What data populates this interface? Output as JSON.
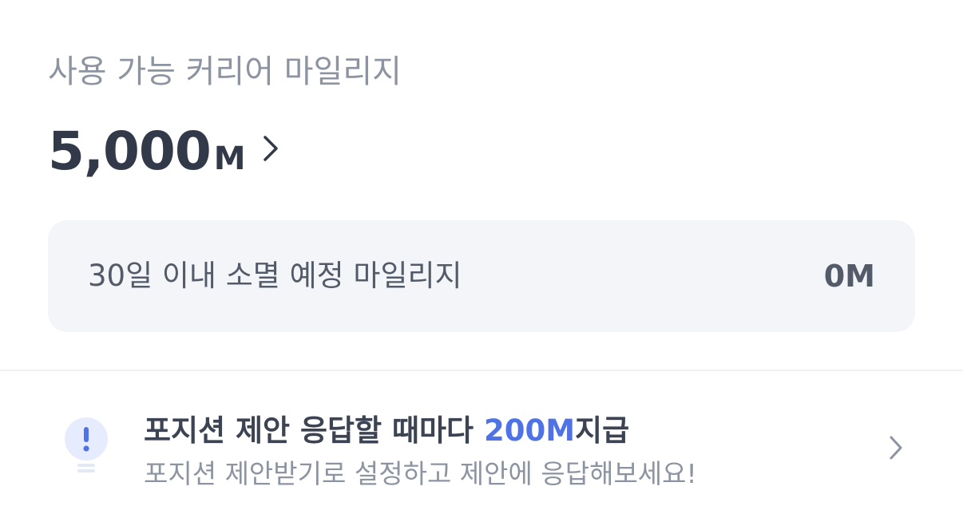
{
  "mileage": {
    "label": "사용 가능 커리어 마일리지",
    "amount": "5,000",
    "unit": "M"
  },
  "expiring": {
    "label": "30일 이내 소멸 예정 마일리지",
    "amount": "0M"
  },
  "promo": {
    "title_prefix": "포지션 제안 응답할 때마다 ",
    "title_highlight": "200M",
    "title_suffix": "지급",
    "subtitle": "포지션 제안받기로 설정하고 제안에 응답해보세요!",
    "icon": "lightbulb-exclamation-icon"
  },
  "colors": {
    "accent": "#4f72e6",
    "primary_text": "#323949",
    "secondary_text": "#8d94a1",
    "box_background": "#f4f5f9",
    "bulb_background": "#e6ecfd"
  }
}
